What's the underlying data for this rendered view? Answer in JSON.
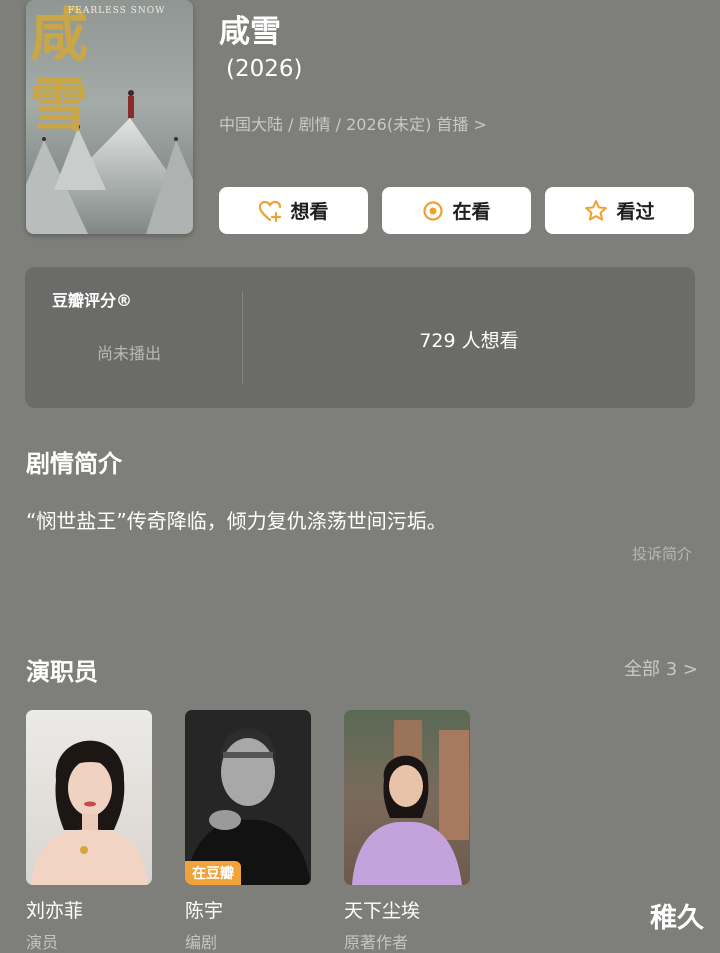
{
  "poster": {
    "title_chars": "咸雪",
    "english_title": "FEARLESS SNOW"
  },
  "movie": {
    "title": "咸雪",
    "year": "(2026)",
    "meta": "中国大陆 / 剧情 / 2026(未定) 首播",
    "meta_chevron": ">"
  },
  "actions": [
    {
      "label": "想看",
      "icon": "heart-plus-icon",
      "color": "#f0a030"
    },
    {
      "label": "在看",
      "icon": "target-circle-icon",
      "color": "#f0a030"
    },
    {
      "label": "看过",
      "icon": "star-outline-icon",
      "color": "#f0a030"
    }
  ],
  "rating": {
    "label": "豆瓣评分®",
    "status": "尚未播出",
    "want_count": "729 人想看"
  },
  "synopsis": {
    "title": "剧情简介",
    "text": "“悯世盐王”传奇降临，倾力复仇涤荡世间污垢。",
    "report_link": "投诉简介"
  },
  "cast": {
    "title": "演职员",
    "see_all": "全部 3",
    "see_all_chevron": ">",
    "members": [
      {
        "name": "刘亦菲",
        "role": "演员",
        "badge": ""
      },
      {
        "name": "陈宇",
        "role": "编剧",
        "badge": "在豆瓣"
      },
      {
        "name": "天下尘埃",
        "role": "原著作者",
        "badge": ""
      }
    ]
  },
  "watermark": "稚久"
}
